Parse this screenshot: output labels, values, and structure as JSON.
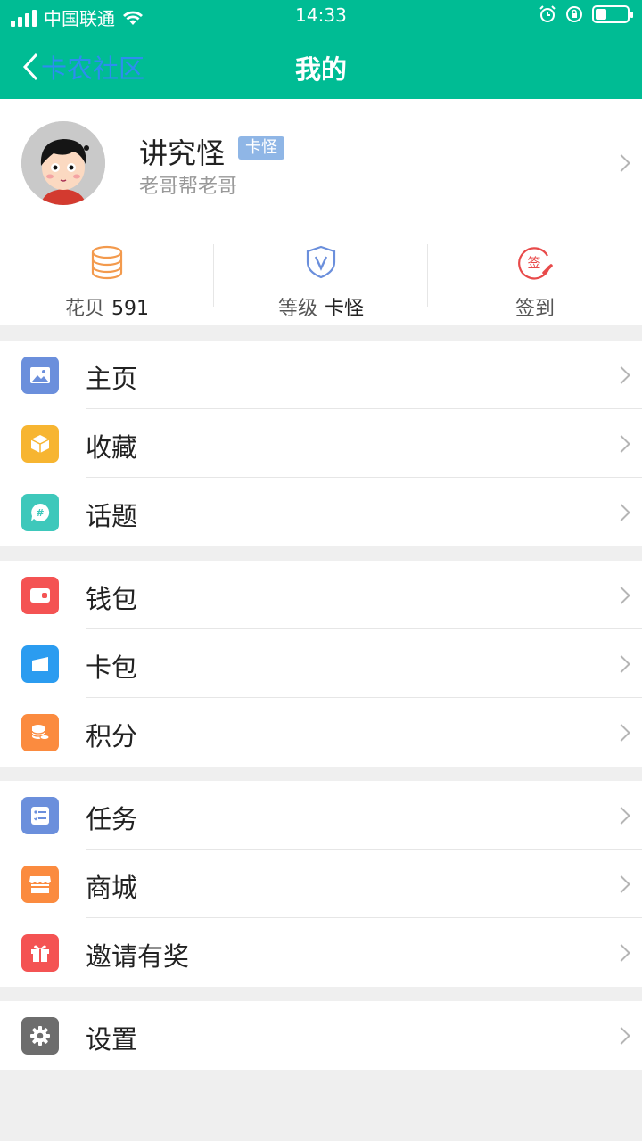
{
  "status": {
    "carrier": "中国联通",
    "time": "14:33"
  },
  "nav": {
    "back_label": "卡农社区",
    "title": "我的"
  },
  "profile": {
    "name": "讲究怪",
    "badge": "卡怪",
    "subtitle": "老哥帮老哥"
  },
  "stats": {
    "beans_label": "花贝",
    "beans_value": "591",
    "level_label": "等级",
    "level_value": "卡怪",
    "checkin_label": "签到",
    "checkin_icon_text": "签"
  },
  "menu": {
    "group1": [
      {
        "label": "主页",
        "icon": "image-icon",
        "color": "#6b8fdc"
      },
      {
        "label": "收藏",
        "icon": "cube-icon",
        "color": "#f7b531"
      },
      {
        "label": "话题",
        "icon": "hashtag-chat-icon",
        "color": "#3ec8bb"
      }
    ],
    "group2": [
      {
        "label": "钱包",
        "icon": "wallet-icon",
        "color": "#f45353"
      },
      {
        "label": "卡包",
        "icon": "card-icon",
        "color": "#2b9cf0"
      },
      {
        "label": "积分",
        "icon": "coins-icon",
        "color": "#fb8b3f"
      }
    ],
    "group3": [
      {
        "label": "任务",
        "icon": "task-list-icon",
        "color": "#6b8fdc"
      },
      {
        "label": "商城",
        "icon": "store-icon",
        "color": "#fb8b3f"
      },
      {
        "label": "邀请有奖",
        "icon": "gift-icon",
        "color": "#f45353"
      }
    ],
    "group4": [
      {
        "label": "设置",
        "icon": "gear-icon",
        "color": "#6d6d6d"
      }
    ]
  },
  "colors": {
    "header_bg": "#00bc94",
    "back_link": "#2d8df0",
    "badge_bg": "#8fb6e6"
  }
}
